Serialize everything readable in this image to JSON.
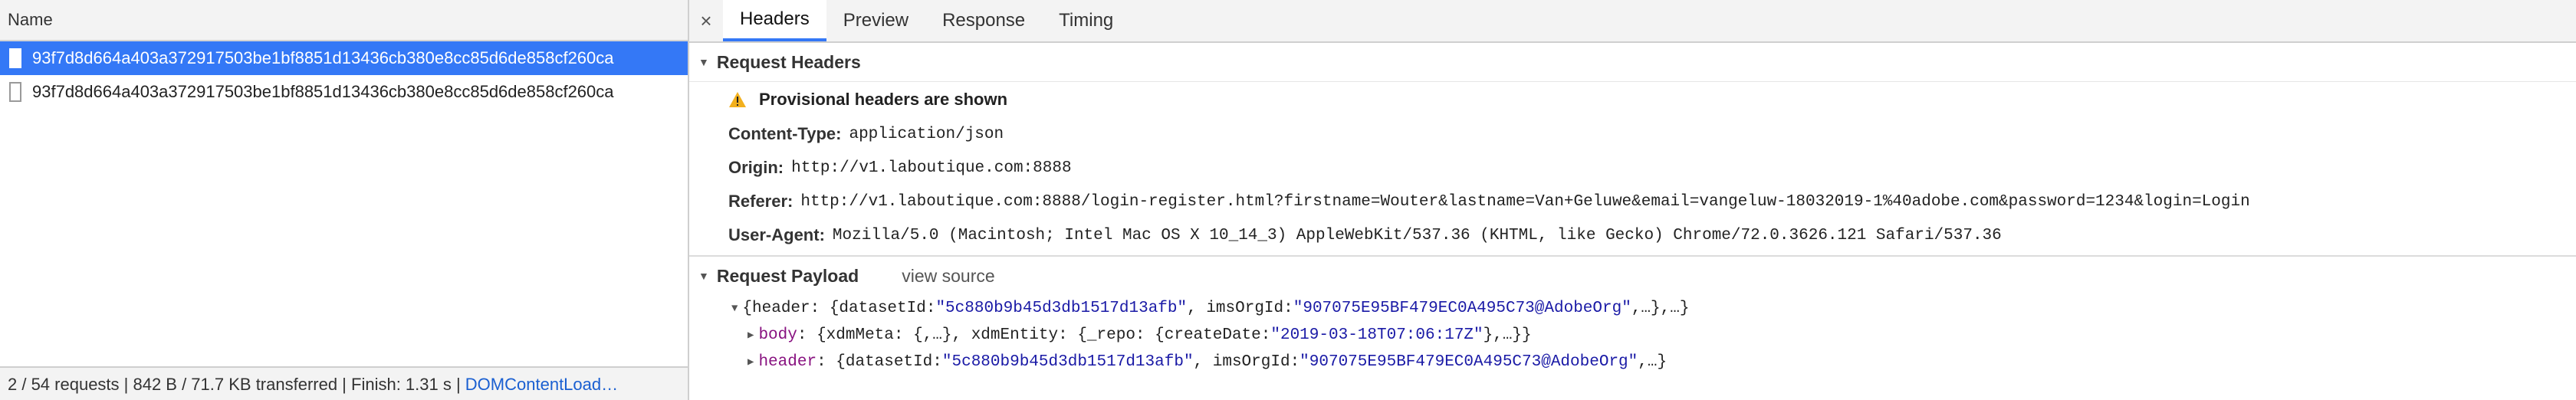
{
  "left_panel": {
    "header": "Name",
    "requests": [
      {
        "name": "93f7d8d664a403a372917503be1bf8851d13436cb380e8cc85d6de858cf260ca",
        "selected": true
      },
      {
        "name": "93f7d8d664a403a372917503be1bf8851d13436cb380e8cc85d6de858cf260ca",
        "selected": false
      }
    ],
    "status": {
      "summary": "2 / 54 requests | 842 B / 71.7 KB transferred | Finish: 1.31 s | ",
      "link": "DOMContentLoad…"
    }
  },
  "tabs": {
    "close": "×",
    "items": [
      "Headers",
      "Preview",
      "Response",
      "Timing"
    ],
    "active": "Headers"
  },
  "request_headers": {
    "title": "Request Headers",
    "provisional": "Provisional headers are shown",
    "rows": [
      {
        "key": "Content-Type:",
        "value": "application/json"
      },
      {
        "key": "Origin:",
        "value": "http://v1.laboutique.com:8888"
      },
      {
        "key": "Referer:",
        "value": "http://v1.laboutique.com:8888/login-register.html?firstname=Wouter&lastname=Van+Geluwe&email=vangeluw-18032019-1%40adobe.com&password=1234&login=Login"
      },
      {
        "key": "User-Agent:",
        "value": "Mozilla/5.0 (Macintosh; Intel Mac OS X 10_14_3) AppleWebKit/537.36 (KHTML, like Gecko) Chrome/72.0.3626.121 Safari/537.36"
      }
    ]
  },
  "request_payload": {
    "title": "Request Payload",
    "view_source": "view source",
    "root": {
      "prefix": "{header: {datasetId: ",
      "s1": "\"5c880b9b45d3db1517d13afb\"",
      "mid": ", imsOrgId: ",
      "s2": "\"907075E95BF479EC0A495C73@AdobeOrg\"",
      "suffix": ",…},…}"
    },
    "body": {
      "key": "body",
      "prefix": ": {xdmMeta: {,…}, xdmEntity: {_repo: {createDate: ",
      "s1": "\"2019-03-18T07:06:17Z\"",
      "suffix": "},…}}"
    },
    "header": {
      "key": "header",
      "prefix": ": {datasetId: ",
      "s1": "\"5c880b9b45d3db1517d13afb\"",
      "mid": ", imsOrgId: ",
      "s2": "\"907075E95BF479EC0A495C73@AdobeOrg\"",
      "suffix": ",…}"
    }
  },
  "colors": {
    "accent": "#3478f6",
    "warning": "#f2b01e",
    "key_purple": "#881280",
    "string_blue": "#1a1aa6"
  }
}
